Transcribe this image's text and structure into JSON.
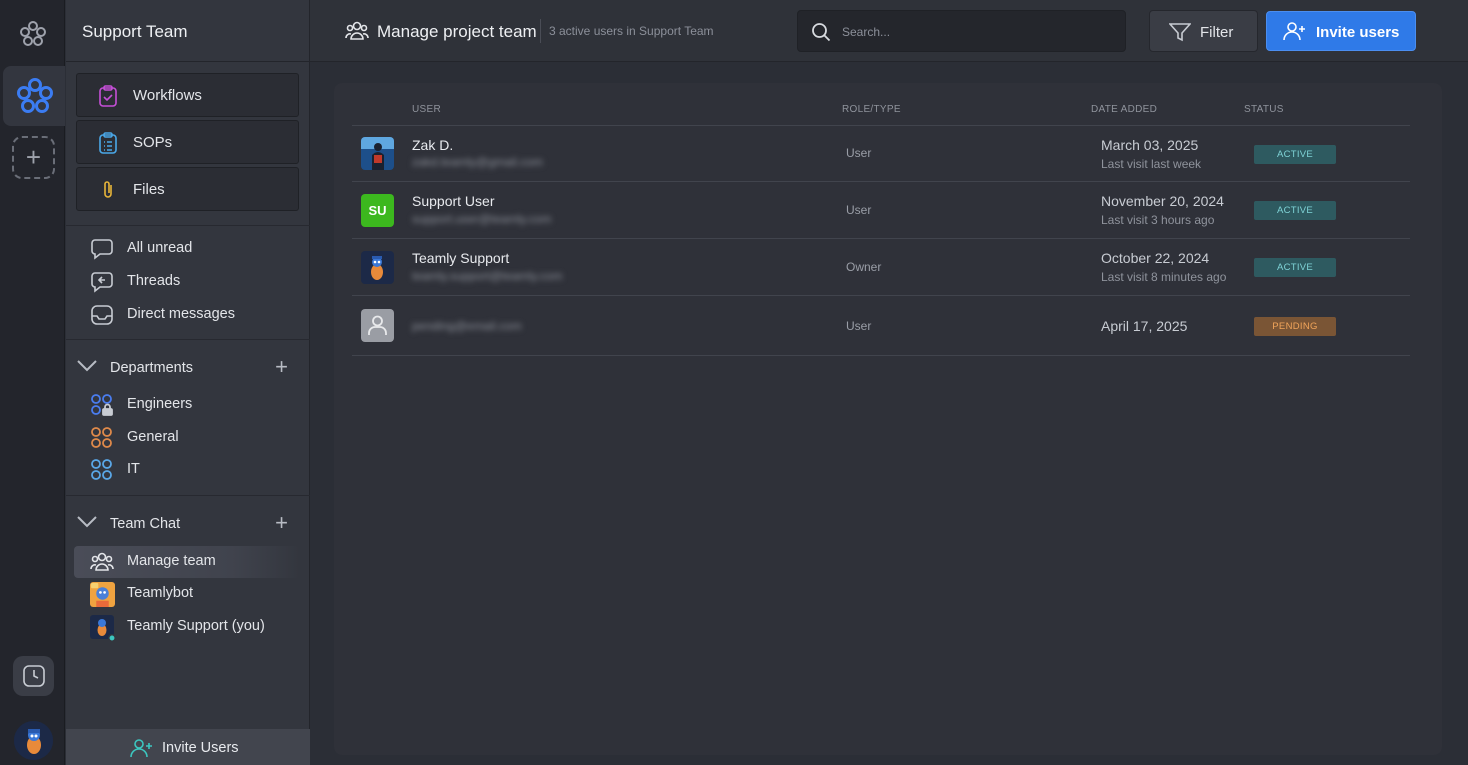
{
  "colors": {
    "accent": "#2f7ae8",
    "active_badge": "#2e5a60",
    "pending_badge": "#7a5535",
    "online": "#3cc7c0"
  },
  "sidebar": {
    "workspace_title": "Support Team",
    "tools": [
      {
        "label": "Workflows",
        "icon": "clipboard-check-icon"
      },
      {
        "label": "SOPs",
        "icon": "clipboard-list-icon"
      },
      {
        "label": "Files",
        "icon": "paperclip-icon"
      }
    ],
    "inbox": [
      {
        "label": "All unread",
        "icon": "chat-bubble-icon"
      },
      {
        "label": "Threads",
        "icon": "threads-icon"
      },
      {
        "label": "Direct messages",
        "icon": "inbox-icon"
      }
    ],
    "departments": {
      "title": "Departments",
      "items": [
        {
          "label": "Engineers",
          "icon": "locked-grid-icon",
          "color": "#4a7df0"
        },
        {
          "label": "General",
          "icon": "grid-icon",
          "color": "#e08a4a"
        },
        {
          "label": "IT",
          "icon": "grid-icon",
          "color": "#5aa8e8"
        }
      ]
    },
    "team_chat": {
      "title": "Team Chat",
      "items": [
        {
          "label": "Manage team",
          "icon": "users-icon"
        },
        {
          "label": "Teamlybot",
          "icon": "teamlybot-avatar"
        },
        {
          "label": "Teamly Support (you)",
          "icon": "support-avatar"
        }
      ]
    },
    "invite_label": "Invite Users"
  },
  "header": {
    "title": "Manage project team",
    "subtitle": "3 active users in Support Team",
    "search_placeholder": "Search...",
    "filter_label": "Filter",
    "invite_label": "Invite users"
  },
  "table": {
    "columns": [
      "USER",
      "ROLE/TYPE",
      "DATE ADDED",
      "STATUS"
    ],
    "rows": [
      {
        "name": "Zak D.",
        "email": "zakd.teamly@gmail.com",
        "role": "User",
        "date": "March 03, 2025",
        "visit": "Last visit last week",
        "status": "ACTIVE",
        "avatar": "photo"
      },
      {
        "name": "Support User",
        "email": "support.user@teamly.com",
        "role": "User",
        "date": "November 20, 2024",
        "visit": "Last visit 3 hours ago",
        "status": "ACTIVE",
        "avatar": "SU"
      },
      {
        "name": "Teamly Support",
        "email": "teamly.support@teamly.com",
        "role": "Owner",
        "date": "October 22, 2024",
        "visit": "Last visit 8 minutes ago",
        "status": "ACTIVE",
        "avatar": "bot"
      },
      {
        "name": "",
        "email": "pending@email.com",
        "role": "User",
        "date": "April 17, 2025",
        "visit": "",
        "status": "PENDING",
        "avatar": "placeholder"
      }
    ]
  }
}
